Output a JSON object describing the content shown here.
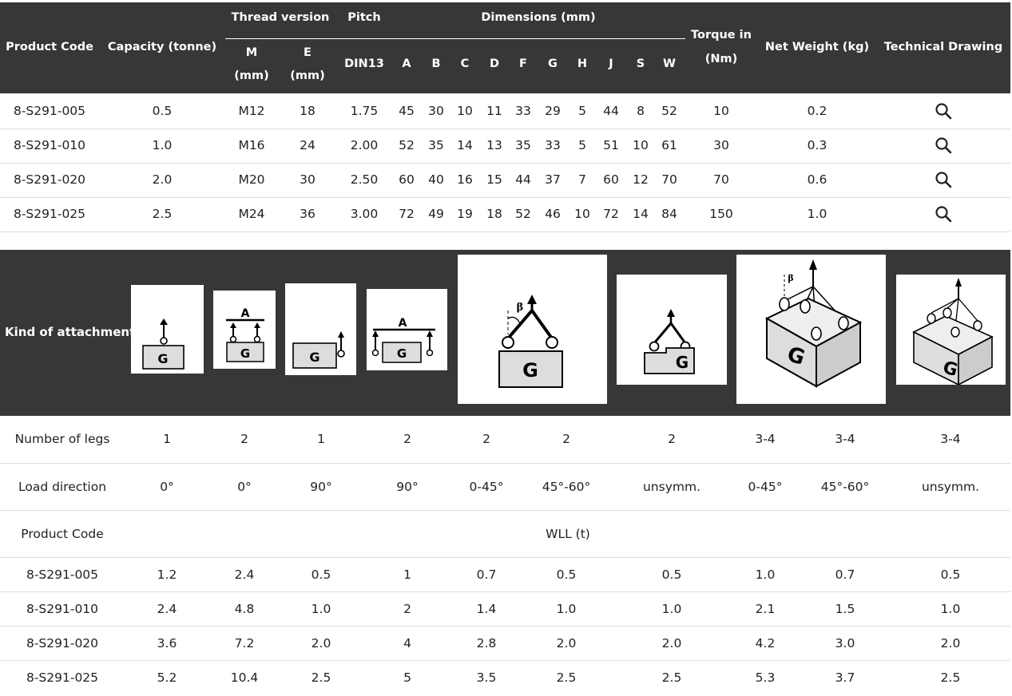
{
  "spec_table": {
    "headers": {
      "product_code": "Product Code",
      "capacity": "Capacity (tonne)",
      "thread_version": "Thread version",
      "pitch": "Pitch",
      "dimensions": "Dimensions (mm)",
      "torque_line1": "Torque in",
      "torque_line2": "(Nm)",
      "net_weight": "Net Weight (kg)",
      "technical_drawing": "Technical Drawing",
      "m_line1": "M",
      "m_line2": "(mm)",
      "e_line1": "E",
      "e_line2": "(mm)",
      "din13": "DIN13",
      "dim_cols": [
        "A",
        "B",
        "C",
        "D",
        "F",
        "G",
        "H",
        "J",
        "S",
        "W"
      ]
    },
    "rows": [
      {
        "code": "8-S291-005",
        "capacity": "0.5",
        "m": "M12",
        "e": "18",
        "pitch": "1.75",
        "dims": [
          "45",
          "30",
          "10",
          "11",
          "33",
          "29",
          "5",
          "44",
          "8",
          "52"
        ],
        "torque": "10",
        "weight": "0.2"
      },
      {
        "code": "8-S291-010",
        "capacity": "1.0",
        "m": "M16",
        "e": "24",
        "pitch": "2.00",
        "dims": [
          "52",
          "35",
          "14",
          "13",
          "35",
          "33",
          "5",
          "51",
          "10",
          "61"
        ],
        "torque": "30",
        "weight": "0.3"
      },
      {
        "code": "8-S291-020",
        "capacity": "2.0",
        "m": "M20",
        "e": "30",
        "pitch": "2.50",
        "dims": [
          "60",
          "40",
          "16",
          "15",
          "44",
          "37",
          "7",
          "60",
          "12",
          "70"
        ],
        "torque": "70",
        "weight": "0.6"
      },
      {
        "code": "8-S291-025",
        "capacity": "2.5",
        "m": "M24",
        "e": "36",
        "pitch": "3.00",
        "dims": [
          "72",
          "49",
          "19",
          "18",
          "52",
          "46",
          "10",
          "72",
          "14",
          "84"
        ],
        "torque": "150",
        "weight": "1.0"
      }
    ],
    "drawing_icon": "magnifier-icon"
  },
  "wll_table": {
    "kind_label": "Kind of attachment",
    "load_symbol": "G",
    "span_symbol": "A",
    "angle_symbol": "β",
    "legs_label": "Number of legs",
    "legs": [
      "1",
      "2",
      "1",
      "2",
      "2",
      "2",
      "2",
      "3-4",
      "3-4",
      "3-4"
    ],
    "direction_label": "Load direction",
    "directions": [
      "0°",
      "0°",
      "90°",
      "90°",
      "0-45°",
      "45°-60°",
      "unsymm.",
      "0-45°",
      "45°-60°",
      "unsymm."
    ],
    "product_code_label": "Product Code",
    "wll_label": "WLL (t)",
    "rows": [
      {
        "code": "8-S291-005",
        "values": [
          "1.2",
          "2.4",
          "0.5",
          "1",
          "0.7",
          "0.5",
          "0.5",
          "1.0",
          "0.7",
          "0.5"
        ]
      },
      {
        "code": "8-S291-010",
        "values": [
          "2.4",
          "4.8",
          "1.0",
          "2",
          "1.4",
          "1.0",
          "1.0",
          "2.1",
          "1.5",
          "1.0"
        ]
      },
      {
        "code": "8-S291-020",
        "values": [
          "3.6",
          "7.2",
          "2.0",
          "4",
          "2.8",
          "2.0",
          "2.0",
          "4.2",
          "3.0",
          "2.0"
        ]
      },
      {
        "code": "8-S291-025",
        "values": [
          "5.2",
          "10.4",
          "2.5",
          "5",
          "3.5",
          "2.5",
          "2.5",
          "5.3",
          "3.7",
          "2.5"
        ]
      }
    ]
  }
}
